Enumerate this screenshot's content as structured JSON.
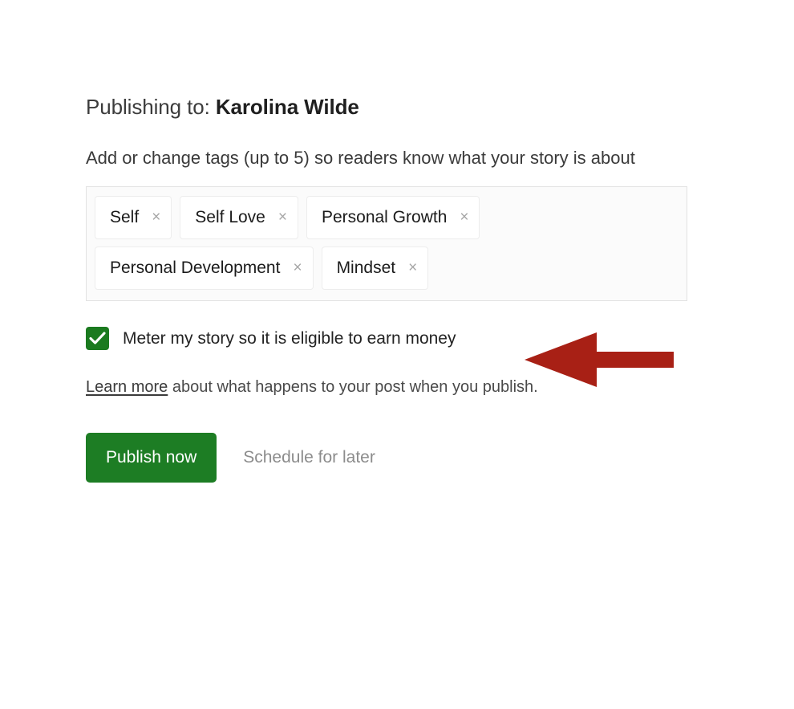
{
  "header": {
    "prefix": "Publishing to: ",
    "author": "Karolina Wilde"
  },
  "tags_section": {
    "description": "Add or change tags (up to 5) so readers know what your story is about",
    "remove_symbol": "×",
    "tags": [
      {
        "label": "Self"
      },
      {
        "label": "Self Love"
      },
      {
        "label": "Personal Growth"
      },
      {
        "label": "Personal Development"
      },
      {
        "label": "Mindset"
      }
    ]
  },
  "meter": {
    "label": "Meter my story so it is eligible to earn money",
    "checked": true,
    "checkbox_color": "#1b7a1f"
  },
  "annotation": {
    "type": "arrow-left",
    "color": "#a82015"
  },
  "learn_more": {
    "link_text": "Learn more",
    "rest_text": " about what happens to your post when you publish."
  },
  "actions": {
    "publish_label": "Publish now",
    "publish_color": "#1d7d24",
    "schedule_label": "Schedule for later"
  }
}
